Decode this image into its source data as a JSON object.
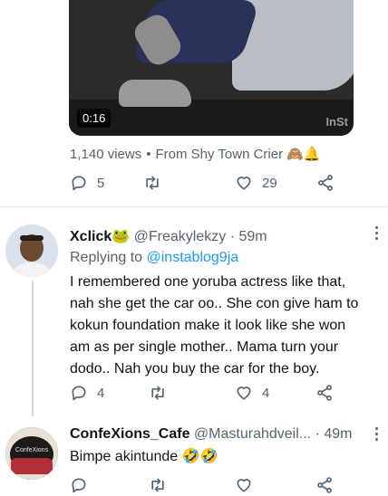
{
  "video": {
    "timer": "0:16",
    "watermark": "InSt"
  },
  "post_meta": {
    "views": "1,140 views",
    "separator": "•",
    "source": "From Shy Town Crier 🙈🔔"
  },
  "post_actions": {
    "replies": "5",
    "likes": "29"
  },
  "reply1": {
    "name": "Xclick🐸",
    "handle": "@Freakylekzy",
    "time_sep": "·",
    "time": "59m",
    "replying_prefix": "Replying to",
    "replying_to": "@instablog9ja",
    "text": "I remembered one yoruba actress like that, nah she get the car oo.. She con give ham to kokun foundation make it look like  she won am as per single mother.. Mama turn your dodo.. Nah you buy the car for the boy.",
    "replies": "4",
    "likes": "4"
  },
  "reply2": {
    "name": "ConfeXions_Cafe",
    "handle": "@Masturahdveil...",
    "time_sep": "·",
    "time": "49m",
    "text": "Bimpe akintunde 🤣🤣",
    "avatar_text": "ConfeXions"
  },
  "colors": {
    "secondary_text": "#536471",
    "link": "#1d9bf0",
    "divider": "#e6e9ec"
  }
}
